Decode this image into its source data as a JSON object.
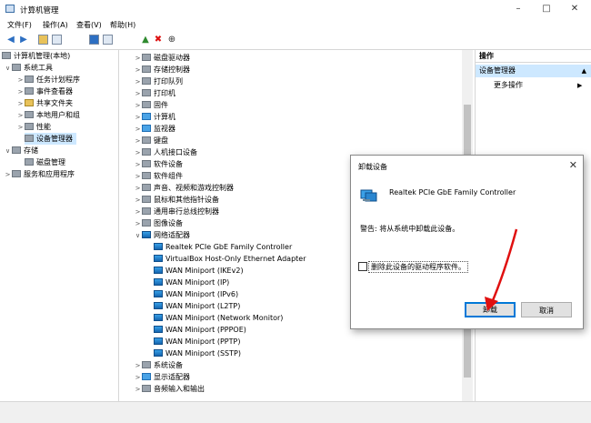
{
  "window": {
    "title": "计算机管理"
  },
  "menu": [
    "文件(F)",
    "操作(A)",
    "查看(V)",
    "帮助(H)"
  ],
  "toolbar": {
    "icons": [
      "back-arrow-icon",
      "forward-arrow-icon",
      "folder-up-icon",
      "grid-icon",
      "help-icon",
      "view-icon",
      "add-driver-icon",
      "remove-x-icon",
      "down-arrow-icon"
    ]
  },
  "left_tree": [
    {
      "label": "计算机管理(本地)",
      "indent": 0,
      "chev": ""
    },
    {
      "label": "系统工具",
      "indent": 1,
      "chev": "∨"
    },
    {
      "label": "任务计划程序",
      "indent": 2,
      "chev": ">"
    },
    {
      "label": "事件查看器",
      "indent": 2,
      "chev": ">"
    },
    {
      "label": "共享文件夹",
      "indent": 2,
      "chev": ">"
    },
    {
      "label": "本地用户和组",
      "indent": 2,
      "chev": ">"
    },
    {
      "label": "性能",
      "indent": 2,
      "chev": ">"
    },
    {
      "label": "设备管理器",
      "indent": 2,
      "chev": "",
      "selected": true
    },
    {
      "label": "存储",
      "indent": 1,
      "chev": "∨"
    },
    {
      "label": "磁盘管理",
      "indent": 2,
      "chev": ""
    },
    {
      "label": "服务和应用程序",
      "indent": 1,
      "chev": ">"
    }
  ],
  "device_tree": [
    {
      "label": "磁盘驱动器",
      "level": 0,
      "chev": ">",
      "icon": "gray"
    },
    {
      "label": "存储控制器",
      "level": 0,
      "chev": ">",
      "icon": "gray"
    },
    {
      "label": "打印队列",
      "level": 0,
      "chev": ">",
      "icon": "gray"
    },
    {
      "label": "打印机",
      "level": 0,
      "chev": ">",
      "icon": "gray"
    },
    {
      "label": "固件",
      "level": 0,
      "chev": ">",
      "icon": "gray"
    },
    {
      "label": "计算机",
      "level": 0,
      "chev": ">",
      "icon": "mon"
    },
    {
      "label": "监视器",
      "level": 0,
      "chev": ">",
      "icon": "mon"
    },
    {
      "label": "键盘",
      "level": 0,
      "chev": ">",
      "icon": "gray"
    },
    {
      "label": "人机接口设备",
      "level": 0,
      "chev": ">",
      "icon": "gray"
    },
    {
      "label": "软件设备",
      "level": 0,
      "chev": ">",
      "icon": "gray"
    },
    {
      "label": "软件组件",
      "level": 0,
      "chev": ">",
      "icon": "gray"
    },
    {
      "label": "声音、视频和游戏控制器",
      "level": 0,
      "chev": ">",
      "icon": "gray"
    },
    {
      "label": "鼠标和其他指针设备",
      "level": 0,
      "chev": ">",
      "icon": "gray"
    },
    {
      "label": "通用串行总线控制器",
      "level": 0,
      "chev": ">",
      "icon": "gray"
    },
    {
      "label": "图像设备",
      "level": 0,
      "chev": ">",
      "icon": "gray"
    },
    {
      "label": "网络适配器",
      "level": 0,
      "chev": "∨",
      "icon": "net"
    },
    {
      "label": "Realtek PCIe GbE Family Controller",
      "level": 1,
      "chev": "",
      "icon": "net"
    },
    {
      "label": "VirtualBox Host-Only Ethernet Adapter",
      "level": 1,
      "chev": "",
      "icon": "net"
    },
    {
      "label": "WAN Miniport (IKEv2)",
      "level": 1,
      "chev": "",
      "icon": "net"
    },
    {
      "label": "WAN Miniport (IP)",
      "level": 1,
      "chev": "",
      "icon": "net"
    },
    {
      "label": "WAN Miniport (IPv6)",
      "level": 1,
      "chev": "",
      "icon": "net"
    },
    {
      "label": "WAN Miniport (L2TP)",
      "level": 1,
      "chev": "",
      "icon": "net"
    },
    {
      "label": "WAN Miniport (Network Monitor)",
      "level": 1,
      "chev": "",
      "icon": "net"
    },
    {
      "label": "WAN Miniport (PPPOE)",
      "level": 1,
      "chev": "",
      "icon": "net"
    },
    {
      "label": "WAN Miniport (PPTP)",
      "level": 1,
      "chev": "",
      "icon": "net"
    },
    {
      "label": "WAN Miniport (SSTP)",
      "level": 1,
      "chev": "",
      "icon": "net"
    },
    {
      "label": "系统设备",
      "level": 0,
      "chev": ">",
      "icon": "gray"
    },
    {
      "label": "显示适配器",
      "level": 0,
      "chev": ">",
      "icon": "mon"
    },
    {
      "label": "音频输入和输出",
      "level": 0,
      "chev": ">",
      "icon": "gray"
    }
  ],
  "actions": {
    "header": "操作",
    "section": "设备管理器",
    "more": "更多操作"
  },
  "dialog": {
    "title": "卸载设备",
    "device_name": "Realtek PCIe GbE Family Controller",
    "warning": "警告: 将从系统中卸载此设备。",
    "checkbox_label": "删除此设备的驱动程序软件。",
    "checkbox_checked": false,
    "uninstall_label": "卸载",
    "cancel_label": "取消"
  }
}
